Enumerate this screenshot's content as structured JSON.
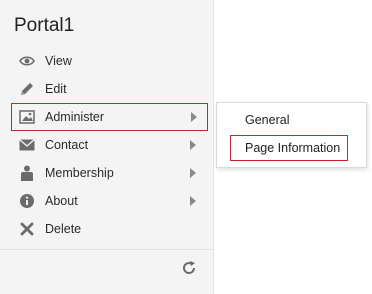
{
  "portal": {
    "title": "Portal1"
  },
  "menu": {
    "items": [
      {
        "label": "View",
        "icon": "eye-icon"
      },
      {
        "label": "Edit",
        "icon": "pencil-icon"
      },
      {
        "label": "Administer",
        "icon": "image-icon",
        "has_submenu": true,
        "highlighted": true
      },
      {
        "label": "Contact",
        "icon": "envelope-icon",
        "has_submenu": true
      },
      {
        "label": "Membership",
        "icon": "person-icon",
        "has_submenu": true
      },
      {
        "label": "About",
        "icon": "info-icon",
        "has_submenu": true
      },
      {
        "label": "Delete",
        "icon": "x-icon"
      }
    ]
  },
  "submenu": {
    "items": [
      {
        "label": "General"
      },
      {
        "label": "Page Information",
        "highlighted": true
      }
    ]
  },
  "colors": {
    "highlight_border": "#c8242b",
    "icon": "#6b6b6b",
    "panel_bg": "#f4f4f4"
  }
}
